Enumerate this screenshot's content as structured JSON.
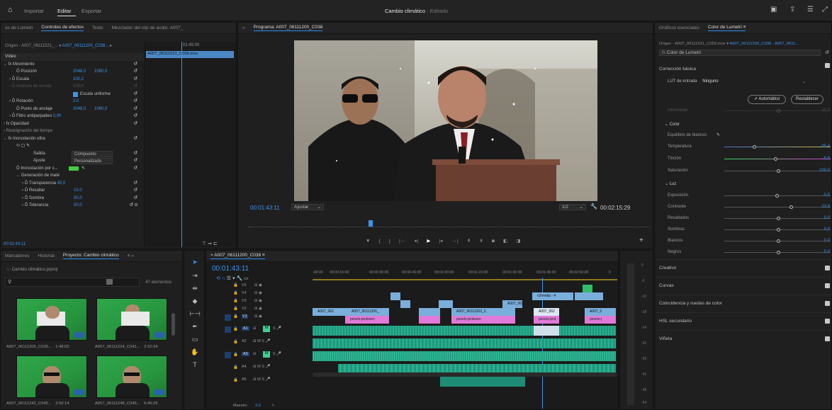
{
  "topbar": {
    "nav": [
      "Importar",
      "Editar",
      "Exportar"
    ],
    "title": "Cambio climático",
    "status": "- Editado"
  },
  "effects": {
    "tabs": [
      "os de Lumetri",
      "Controles de efectos",
      "Texto",
      "Mezclador del clip de audio: A007_"
    ],
    "source": "Origen - A007_06111521_...",
    "clip": "A007_06111200_C038...",
    "seq_clip": "A007_06111521_C059.mov",
    "seq_time": "01:45:00",
    "video_label": "Vídeo",
    "rows": [
      {
        "label": "fx  Movimiento",
        "v1": "",
        "v2": ""
      },
      {
        "label": "Posición",
        "v1": "2048,0",
        "v2": "1080,0"
      },
      {
        "label": "Escala",
        "v1": "100,2",
        "v2": ""
      },
      {
        "label": "Anchura de escala",
        "v1": "100,0",
        "v2": ""
      },
      {
        "label": "Escala uniforme",
        "v1": "",
        "v2": ""
      },
      {
        "label": "Rotación",
        "v1": "0,0",
        "v2": ""
      },
      {
        "label": "Punto de anclaje",
        "v1": "2048,0",
        "v2": "1080,0"
      },
      {
        "label": "Filtro antiparpadeo",
        "v1": "0,00",
        "v2": ""
      },
      {
        "label": "fx  Opacidad",
        "v1": "",
        "v2": ""
      },
      {
        "label": "Reasignación del tiempo",
        "v1": "",
        "v2": ""
      },
      {
        "label": "fx  Incrustación ultra",
        "v1": "",
        "v2": ""
      },
      {
        "label": "",
        "v1": "",
        "v2": ""
      },
      {
        "label": "Salida",
        "v1": "Compuesto",
        "v2": ""
      },
      {
        "label": "Ajuste",
        "v1": "Personalizado",
        "v2": ""
      },
      {
        "label": "Incrustación por c...",
        "v1": "",
        "v2": ""
      },
      {
        "label": "Generación de mate",
        "v1": "",
        "v2": ""
      },
      {
        "label": "Transparencia",
        "v1": "45,0",
        "v2": ""
      },
      {
        "label": "Resaltar",
        "v1": "10,0",
        "v2": ""
      },
      {
        "label": "Sombra",
        "v1": "50,0",
        "v2": ""
      },
      {
        "label": "Tolerancia",
        "v1": "50,0",
        "v2": ""
      }
    ],
    "time": "00:01:43:11"
  },
  "program": {
    "title": "Programa: A007_06111200_C038",
    "timecode": "00:01:43:11",
    "fit": "Ajustar",
    "ratio": "1/2",
    "duration": "00:02:15:29"
  },
  "project": {
    "tabs": [
      "Marcadores",
      "Historial",
      "Proyecto: Cambio climático"
    ],
    "file": "Cambio climático.prproj",
    "count": "47 elementos",
    "items": [
      {
        "name": "A007_06111205_C039...",
        "dur": "1:48:02"
      },
      {
        "name": "A007_06111224_C041...",
        "dur": "2:10:24"
      },
      {
        "name": "A007_06111242_C045...",
        "dur": "3:50:14"
      },
      {
        "name": "A007_06111248_C046...",
        "dur": "6:49:25"
      }
    ]
  },
  "timeline": {
    "title": "A007_06111200_C038",
    "time": "00:01:43:11",
    "ruler": [
      "-00:00",
      "00:00:15:00",
      "00:00:30:00",
      "00:00:45:00",
      "00:01:00:00",
      "00:01:15:00",
      "00:01:30:00",
      "00:01:45:00",
      "00:02:00:00",
      "0"
    ],
    "tracks": [
      "V5",
      "V4",
      "V3",
      "V2",
      "V1",
      "A1",
      "A2",
      "A3",
      "A4",
      "A5"
    ],
    "mix": "Maestro",
    "mix_val": "0,0",
    "clips": {
      "c1": "A007_062",
      "c2": "A007_06111205_",
      "c3": "A007_06111203_C",
      "c4": "A007_062",
      "c5": "A007_062",
      "c6": "A007_0",
      "p1": "pexels-jentssen",
      "p2": "pexels-jentssen",
      "p3": "pexels-jent",
      "p4": "pexels-j",
      "v": "v2media - 4"
    }
  },
  "meter": {
    "ticks": [
      "0",
      "-6",
      "-12",
      "-18",
      "-24",
      "-30",
      "-36",
      "-42",
      "-48",
      "-54"
    ]
  },
  "lumetri": {
    "tabs": [
      "Gráficos esenciales",
      "Color de Lumetri"
    ],
    "source": "Origen - A007_06111521_C059.mov",
    "seq": "A007_06111200_C038 - A007_0611...",
    "fx": "Color de Lumetri",
    "basic": "Corrección básica",
    "lut_label": "LUT de entrada",
    "lut_value": "Ninguno",
    "auto": "Automático",
    "reset": "Restablecer",
    "intensity": "Intensidad",
    "intensity_val": "10,0",
    "color": "Color",
    "wb": "Equilibrio de blancos",
    "sliders": [
      {
        "label": "Temperatura",
        "value": "-35,4"
      },
      {
        "label": "Tinción",
        "value": "-5,8"
      },
      {
        "label": "Saturación",
        "value": "100,0"
      }
    ],
    "light": "Luz",
    "lights": [
      {
        "label": "Exposición",
        "value": "-0,5"
      },
      {
        "label": "Contraste",
        "value": "23,8"
      },
      {
        "label": "Resaltados",
        "value": "0,0"
      },
      {
        "label": "Sombras",
        "value": "0,0"
      },
      {
        "label": "Blancos",
        "value": "0,0"
      },
      {
        "label": "Negros",
        "value": "0,0"
      }
    ],
    "sections": [
      "Creativo",
      "Curvas",
      "Coincidencia y ruedas de color",
      "HSL secundario",
      "Viñeta"
    ]
  }
}
